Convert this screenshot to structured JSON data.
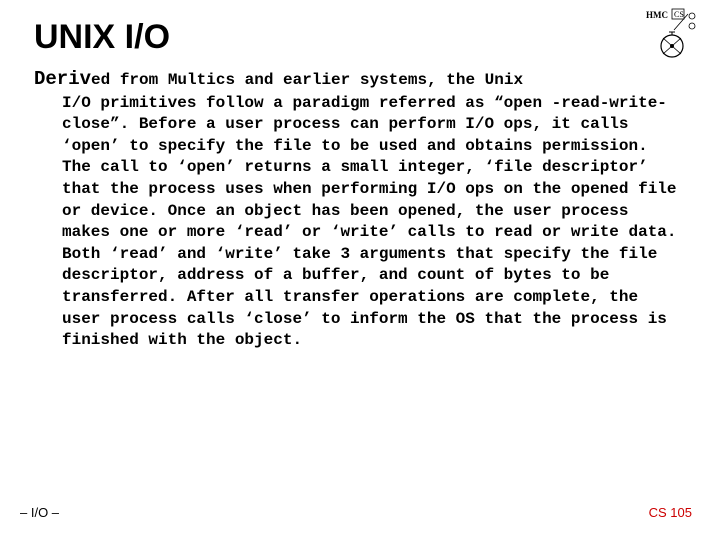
{
  "title": "UNIX I/O",
  "dropcap": "Deriv",
  "first_line": "ed from Multics and earlier systems, the Unix",
  "body_rest": "I/O primitives follow a paradigm referred as “open -read-write-close”. Before a user process can perform I/O ops, it calls ‘open’ to specify the file to be used and obtains permission.  The call to ‘open’ returns a small integer, ‘file descriptor’ that the process uses when performing I/O ops on the opened file or device.  Once an object has been opened, the user process makes one or more ‘read’ or ‘write’ calls to read or write data.  Both ‘read’ and ‘write’ take 3 arguments that specify the file descriptor, address of a buffer, and count of bytes to be transferred.  After all transfer operations are complete, the user process calls ‘close’ to inform the OS that the process is finished with the object.",
  "footer_left": "– I/O –",
  "footer_right": "CS 105",
  "logo_text": "HMC CS"
}
